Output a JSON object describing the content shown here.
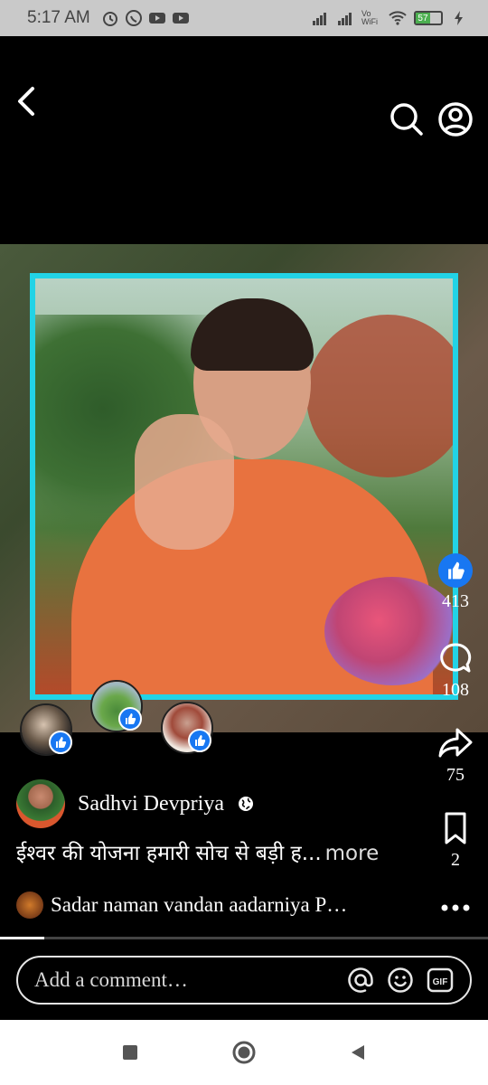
{
  "status_bar": {
    "time": "5:17 AM",
    "network_label": "Vo WiFi",
    "battery": 57,
    "battery_label": "57"
  },
  "nav": {
    "back_icon": "chevron-left-icon",
    "search_icon": "search-icon",
    "profile_icon": "profile-icon"
  },
  "reactions": {
    "likes_count": "413",
    "comments_count": "108",
    "shares_count": "75",
    "saves_count": "2"
  },
  "post": {
    "author_name": "Sadhvi Devpriya",
    "caption": "ईश्वर की योजना हमारी सोच से बड़ी ह...",
    "more_label": "more",
    "top_comment": "Sadar naman vandan aadarniya P…"
  },
  "video_progress": 0.09,
  "comment_box": {
    "placeholder": "Add a comment…",
    "gif_label": "GIF"
  },
  "colors": {
    "accent_blue": "#1877f2",
    "frame_cyan": "#22d3e6",
    "robe_orange": "#e8723f"
  }
}
